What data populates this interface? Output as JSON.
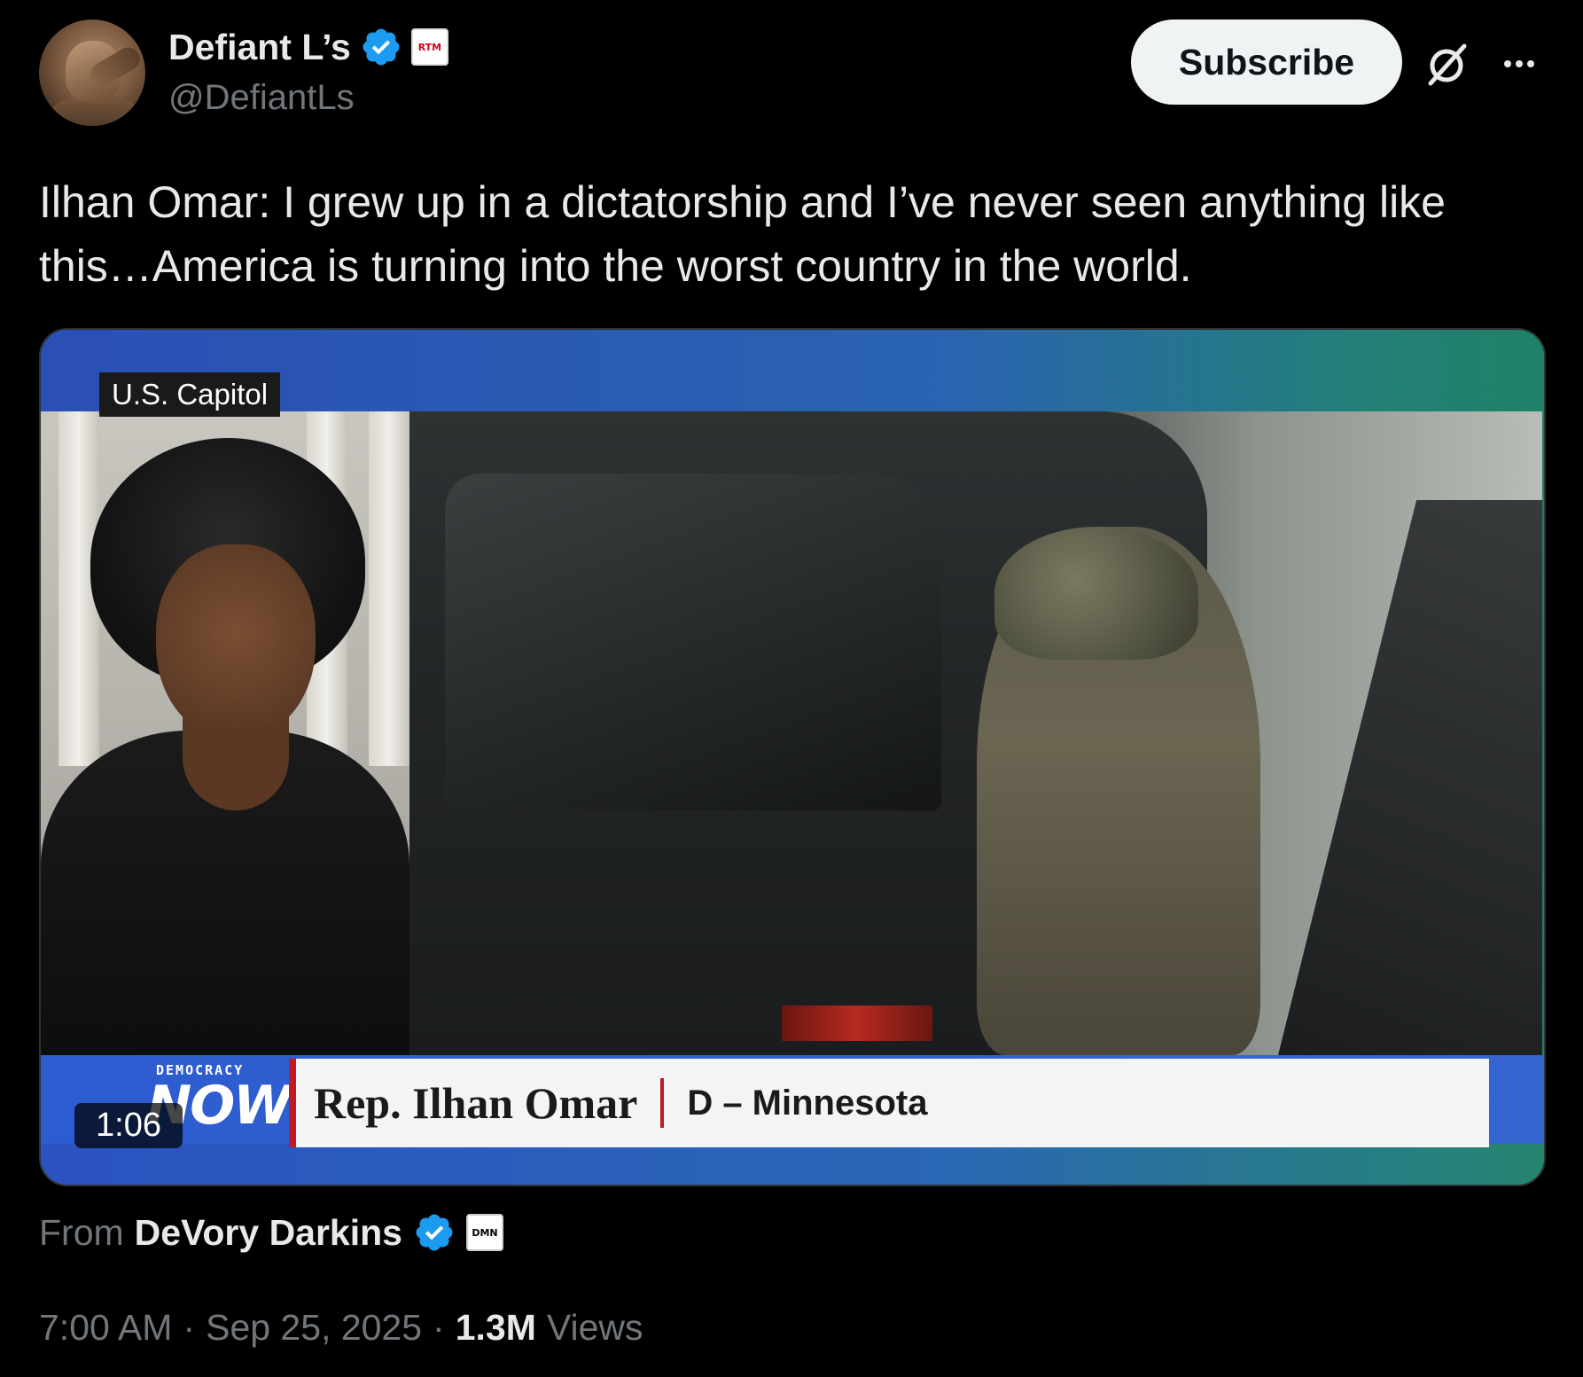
{
  "author": {
    "display_name": "Defiant L’s",
    "handle": "@DefiantLs",
    "verified": true,
    "affiliate_badge_text": "RTM"
  },
  "header": {
    "subscribe_label": "Subscribe",
    "grok_icon": "grok-icon",
    "more_icon": "more-icon"
  },
  "tweet": {
    "text": "Ilhan Omar: I grew up in a dictatorship and I’ve never seen anything like this…America is turning into the worst country in the world."
  },
  "media": {
    "location_tag": "U.S. Capitol",
    "show_logo_small": "DEMOCRACY",
    "show_logo_big": "NOW!",
    "lower_third_name": "Rep. Ilhan Omar",
    "lower_third_district": "D – Minnesota",
    "duration": "1:06"
  },
  "attribution": {
    "from_label": "From",
    "source_name": "DeVory Darkins",
    "source_badge_text": "DMN"
  },
  "meta": {
    "time": "7:00 AM",
    "separator": "·",
    "date": "Sep 25, 2025",
    "views_count": "1.3M",
    "views_label": "Views"
  },
  "colors": {
    "background": "#000000",
    "text_primary": "#e7e9ea",
    "text_secondary": "#71767b",
    "verified_blue": "#1d9bf0",
    "subscribe_bg": "#eff3f4"
  }
}
